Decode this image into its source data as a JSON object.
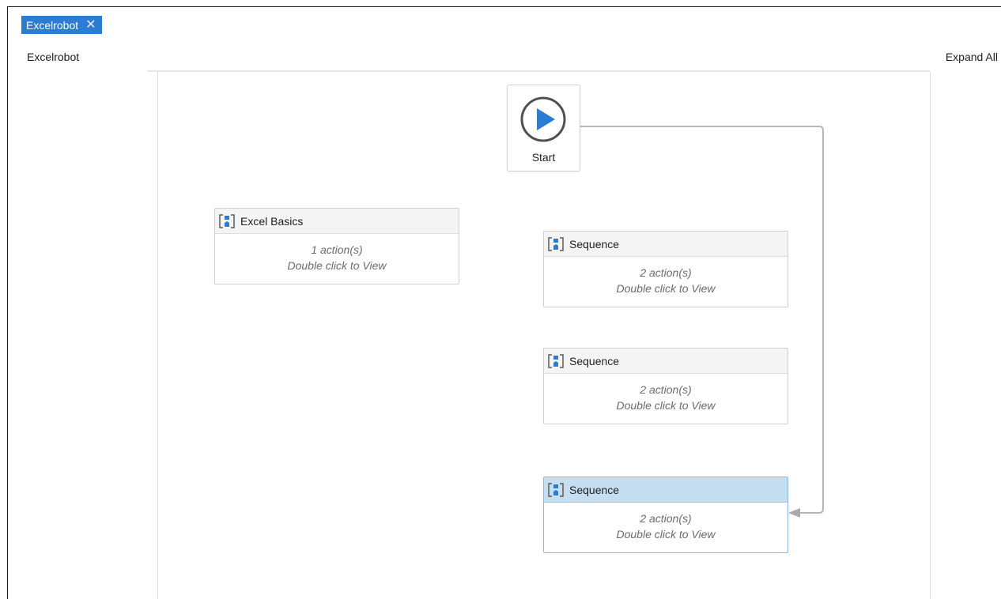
{
  "tab": {
    "title": "Excelrobot",
    "close_glyph": "✕"
  },
  "breadcrumb": {
    "label": "Excelrobot"
  },
  "toolbar": {
    "expand_all": "Expand All"
  },
  "start_node": {
    "label": "Start",
    "icon": "play-circle-icon"
  },
  "activities": [
    {
      "title": "Excel Basics",
      "count_text": "1 action(s)",
      "hint": "Double click to View",
      "icon": "sequence-icon",
      "selected": false
    },
    {
      "title": "Sequence",
      "count_text": "2 action(s)",
      "hint": "Double click to View",
      "icon": "sequence-icon",
      "selected": false
    },
    {
      "title": "Sequence",
      "count_text": "2 action(s)",
      "hint": "Double click to View",
      "icon": "sequence-icon",
      "selected": false
    },
    {
      "title": "Sequence",
      "count_text": "2 action(s)",
      "hint": "Double click to View",
      "icon": "sequence-icon",
      "selected": true
    }
  ],
  "colors": {
    "accent": "#2b7cd3",
    "selected_header": "#c6def2",
    "connector": "#b5b5b5"
  }
}
